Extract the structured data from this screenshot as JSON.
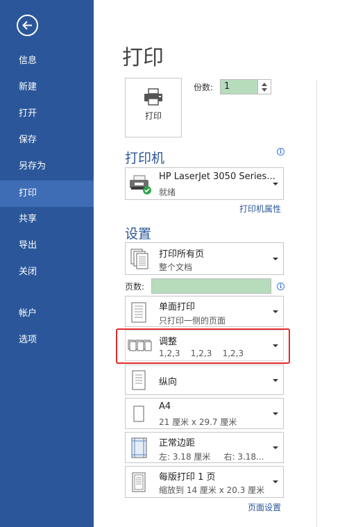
{
  "sidebar": {
    "back_icon": "arrow-left-icon",
    "items": [
      {
        "label": "信息"
      },
      {
        "label": "新建"
      },
      {
        "label": "打开"
      },
      {
        "label": "保存"
      },
      {
        "label": "另存为"
      },
      {
        "label": "打印",
        "active": true
      },
      {
        "label": "共享"
      },
      {
        "label": "导出"
      },
      {
        "label": "关闭"
      },
      {
        "label": "帐户"
      },
      {
        "label": "选项"
      }
    ],
    "colors": {
      "background": "#2b579a",
      "active": "#3e6db5"
    }
  },
  "main": {
    "title": "打印",
    "print_button_label": "打印",
    "copies_label": "份数:",
    "copies_value": "1"
  },
  "printer": {
    "heading": "打印机",
    "name": "HP LaserJet 3050 Series...",
    "status": "就绪",
    "properties_link": "打印机属性"
  },
  "settings": {
    "heading": "设置",
    "print_range": {
      "title": "打印所有页",
      "subtitle": "整个文档"
    },
    "pages_label": "页数:",
    "pages_value": "",
    "sides": {
      "title": "单面打印",
      "subtitle": "只打印一侧的页面"
    },
    "collate": {
      "title": "调整",
      "subtitle": "1,2,3    1,2,3    1,2,3"
    },
    "orientation": {
      "title": "纵向"
    },
    "paper": {
      "title": "A4",
      "subtitle": "21 厘米 x 29.7 厘米"
    },
    "margins": {
      "title": "正常边距",
      "subtitle": "左: 3.18 厘米     右: 3.18..."
    },
    "scaling": {
      "title": "每版打印 1 页",
      "subtitle": "缩放到 14 厘米 x 20.3 厘米"
    },
    "page_setup_link": "页面设置"
  },
  "colors": {
    "accent": "#2b579a",
    "input_fill": "#b6dcbc",
    "highlight": "#e32a2a"
  }
}
